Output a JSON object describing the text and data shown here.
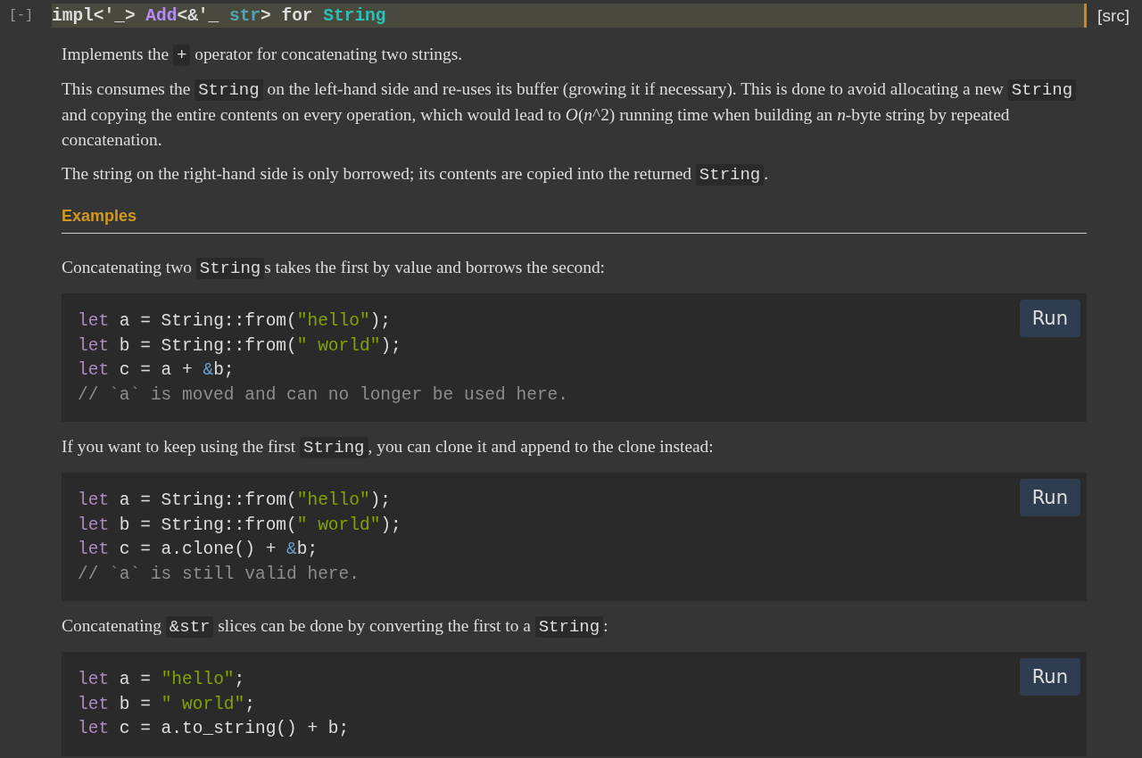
{
  "header": {
    "toggle": "[-]",
    "signature": [
      {
        "kind": "plain",
        "text": "impl<'_> "
      },
      {
        "kind": "trait",
        "text": "Add"
      },
      {
        "kind": "plain",
        "text": "<&'_ "
      },
      {
        "kind": "primitive",
        "text": "str"
      },
      {
        "kind": "plain",
        "text": "> for "
      },
      {
        "kind": "type",
        "text": "String"
      }
    ],
    "src_link": "[src]"
  },
  "blocks": [
    {
      "kind": "paragraph",
      "segments": [
        {
          "kind": "text",
          "text": "Implements the "
        },
        {
          "kind": "code",
          "text": "+"
        },
        {
          "kind": "text",
          "text": " operator for concatenating two strings."
        }
      ]
    },
    {
      "kind": "paragraph",
      "segments": [
        {
          "kind": "text",
          "text": "This consumes the "
        },
        {
          "kind": "code",
          "text": "String"
        },
        {
          "kind": "text",
          "text": " on the left-hand side and re-uses its buffer (growing it if necessary). This is done to avoid allocating a new "
        },
        {
          "kind": "code",
          "text": "String"
        },
        {
          "kind": "text",
          "text": " and copying the entire contents on every operation, which would lead to *O*(*n*^2) running time when building an *n*-byte string by repeated concatenation."
        }
      ]
    },
    {
      "kind": "paragraph",
      "segments": [
        {
          "kind": "text",
          "text": "The string on the right-hand side is only borrowed; its contents are copied into the returned "
        },
        {
          "kind": "code",
          "text": "String"
        },
        {
          "kind": "text",
          "text": "."
        }
      ]
    },
    {
      "kind": "heading",
      "text": "Examples"
    },
    {
      "kind": "paragraph",
      "segments": [
        {
          "kind": "text",
          "text": "Concatenating two "
        },
        {
          "kind": "code",
          "text": "String"
        },
        {
          "kind": "text",
          "text": "s takes the first by value and borrows the second:"
        }
      ]
    },
    {
      "kind": "code",
      "run_button": "Run",
      "lines": [
        [
          {
            "kind": "keyword",
            "text": "let"
          },
          {
            "kind": "plain",
            "text": " a = String::from("
          },
          {
            "kind": "string",
            "text": "\"hello\""
          },
          {
            "kind": "plain",
            "text": ");"
          }
        ],
        [
          {
            "kind": "keyword",
            "text": "let"
          },
          {
            "kind": "plain",
            "text": " b = String::from("
          },
          {
            "kind": "string",
            "text": "\" world\""
          },
          {
            "kind": "plain",
            "text": ");"
          }
        ],
        [
          {
            "kind": "keyword",
            "text": "let"
          },
          {
            "kind": "plain",
            "text": " c = a + "
          },
          {
            "kind": "operator",
            "text": "&"
          },
          {
            "kind": "plain",
            "text": "b;"
          }
        ],
        [
          {
            "kind": "comment",
            "text": "// `a` is moved and can no longer be used here."
          }
        ]
      ]
    },
    {
      "kind": "paragraph",
      "segments": [
        {
          "kind": "text",
          "text": "If you want to keep using the first "
        },
        {
          "kind": "code",
          "text": "String"
        },
        {
          "kind": "text",
          "text": ", you can clone it and append to the clone instead:"
        }
      ]
    },
    {
      "kind": "code",
      "run_button": "Run",
      "lines": [
        [
          {
            "kind": "keyword",
            "text": "let"
          },
          {
            "kind": "plain",
            "text": " a = String::from("
          },
          {
            "kind": "string",
            "text": "\"hello\""
          },
          {
            "kind": "plain",
            "text": ");"
          }
        ],
        [
          {
            "kind": "keyword",
            "text": "let"
          },
          {
            "kind": "plain",
            "text": " b = String::from("
          },
          {
            "kind": "string",
            "text": "\" world\""
          },
          {
            "kind": "plain",
            "text": ");"
          }
        ],
        [
          {
            "kind": "keyword",
            "text": "let"
          },
          {
            "kind": "plain",
            "text": " c = a.clone() + "
          },
          {
            "kind": "operator",
            "text": "&"
          },
          {
            "kind": "plain",
            "text": "b;"
          }
        ],
        [
          {
            "kind": "comment",
            "text": "// `a` is still valid here."
          }
        ]
      ]
    },
    {
      "kind": "paragraph",
      "segments": [
        {
          "kind": "text",
          "text": "Concatenating "
        },
        {
          "kind": "code",
          "text": "&str"
        },
        {
          "kind": "text",
          "text": " slices can be done by converting the first to a "
        },
        {
          "kind": "code",
          "text": "String"
        },
        {
          "kind": "text",
          "text": ":"
        }
      ]
    },
    {
      "kind": "code",
      "run_button": "Run",
      "lines": [
        [
          {
            "kind": "keyword",
            "text": "let"
          },
          {
            "kind": "plain",
            "text": " a = "
          },
          {
            "kind": "string",
            "text": "\"hello\""
          },
          {
            "kind": "plain",
            "text": ";"
          }
        ],
        [
          {
            "kind": "keyword",
            "text": "let"
          },
          {
            "kind": "plain",
            "text": " b = "
          },
          {
            "kind": "string",
            "text": "\" world\""
          },
          {
            "kind": "plain",
            "text": ";"
          }
        ],
        [
          {
            "kind": "keyword",
            "text": "let"
          },
          {
            "kind": "plain",
            "text": " c = a.to_string() + b;"
          }
        ]
      ]
    }
  ]
}
